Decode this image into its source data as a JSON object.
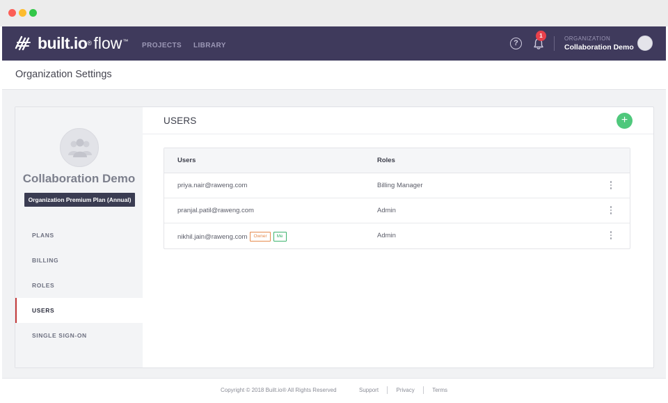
{
  "brand": {
    "name": "built.io",
    "reg": "®",
    "product": "flow",
    "tm": "™"
  },
  "nav": {
    "projects": "PROJECTS",
    "library": "LIBRARY"
  },
  "notifications": {
    "count": "1"
  },
  "help": {
    "glyph": "?"
  },
  "organization": {
    "label": "ORGANIZATION",
    "name": "Collaboration Demo"
  },
  "page": {
    "title": "Organization Settings"
  },
  "sidebar": {
    "org_name": "Collaboration Demo",
    "plan": "Organization Premium Plan (Annual)",
    "items": [
      {
        "label": "PLANS",
        "active": false
      },
      {
        "label": "BILLING",
        "active": false
      },
      {
        "label": "ROLES",
        "active": false
      },
      {
        "label": "USERS",
        "active": true
      },
      {
        "label": "SINGLE SIGN-ON",
        "active": false
      }
    ]
  },
  "users_panel": {
    "title": "USERS",
    "add_glyph": "+",
    "columns": {
      "users": "Users",
      "roles": "Roles"
    },
    "rows": [
      {
        "email": "priya.nair@raweng.com",
        "role": "Billing Manager",
        "tags": []
      },
      {
        "email": "pranjal.patil@raweng.com",
        "role": "Admin",
        "tags": []
      },
      {
        "email": "nikhil.jain@raweng.com",
        "role": "Admin",
        "tags": [
          "Owner",
          "Me"
        ]
      }
    ]
  },
  "footer": {
    "copyright": "Copyright © 2018 Built.io® All Rights Reserved",
    "support": "Support",
    "privacy": "Privacy",
    "terms": "Terms"
  },
  "colors": {
    "nav_bg": "#3f3a5c",
    "add_button": "#4fc87c",
    "active_indicator": "#c43a3a",
    "badge": "#e8414b",
    "owner_tag": "#e58a4c",
    "me_tag": "#3cb36d"
  },
  "icons": [
    "help-icon",
    "bell-icon",
    "plus-icon",
    "users-group-icon",
    "kebab-menu-icon",
    "logo-mark-icon"
  ]
}
